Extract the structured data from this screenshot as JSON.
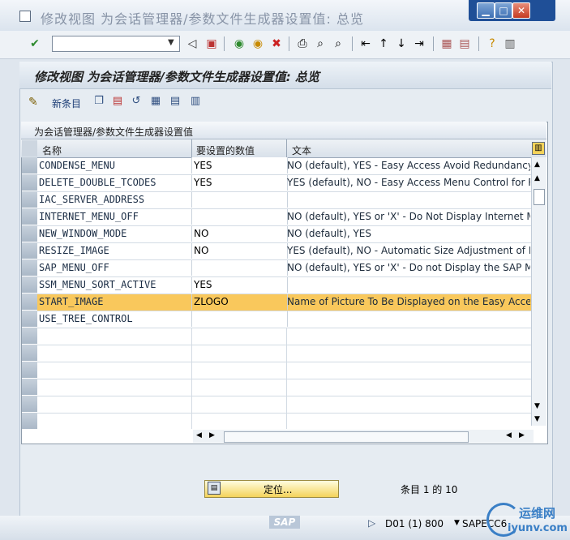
{
  "window": {
    "title": "修改视图 为会话管理器/参数文件生成器设置值: 总览",
    "minimize": "▁",
    "maximize": "□",
    "close": "✕"
  },
  "toolbar": {
    "command_field_value": "",
    "icons": [
      "check-icon",
      "back-arrow-icon",
      "save-icon",
      "back-green-icon",
      "exit-icon",
      "cancel-icon",
      "print-icon",
      "find-icon",
      "find-next-icon",
      "first-page-icon",
      "prev-page-icon",
      "next-page-icon",
      "last-page-icon",
      "new-session-icon",
      "shortcut-icon",
      "help-icon",
      "layout-icon"
    ]
  },
  "screen": {
    "title": "修改视图 为会话管理器/参数文件生成器设置值: 总览",
    "new_entries_label": "新条目"
  },
  "table": {
    "caption": "为会话管理器/参数文件生成器设置值",
    "columns": [
      "名称",
      "要设置的数值",
      "文本"
    ],
    "rows": [
      {
        "name": "CONDENSE_MENU",
        "value": "YES",
        "text": "NO (default), YES - Easy Access Avoid Redundancy (No"
      },
      {
        "name": "DELETE_DOUBLE_TCODES",
        "value": "YES",
        "text": "YES (default), NO - Easy Access Menu Control for Rem"
      },
      {
        "name": "IAC_SERVER_ADDRESS",
        "value": "",
        "text": ""
      },
      {
        "name": "INTERNET_MENU_OFF",
        "value": "",
        "text": "NO (default), YES or 'X' - Do Not Display Internet Metr"
      },
      {
        "name": "NEW_WINDOW_MODE",
        "value": "NO",
        "text": "NO (default), YES"
      },
      {
        "name": "RESIZE_IMAGE",
        "value": "NO",
        "text": "YES (default), NO - Automatic Size Adjustment of Pict"
      },
      {
        "name": "SAP_MENU_OFF",
        "value": "",
        "text": "NO (default), YES or 'X' -  Do not Display the SAP Men"
      },
      {
        "name": "SSM_MENU_SORT_ACTIVE",
        "value": "YES",
        "text": ""
      },
      {
        "name": "START_IMAGE",
        "value": "ZLOGO",
        "text": "Name of Picture To Be Displayed on the Easy Access S"
      },
      {
        "name": "USE_TREE_CONTROL",
        "value": "",
        "text": ""
      }
    ]
  },
  "footer": {
    "position_button": "定位...",
    "entry_count": "条目 1 的 10"
  },
  "status": {
    "sap_logo": "SAP",
    "system": "D01 (1) 800",
    "host": "SAPECC6",
    "watermark1": "运维网",
    "watermark2": "iyunv.com"
  }
}
